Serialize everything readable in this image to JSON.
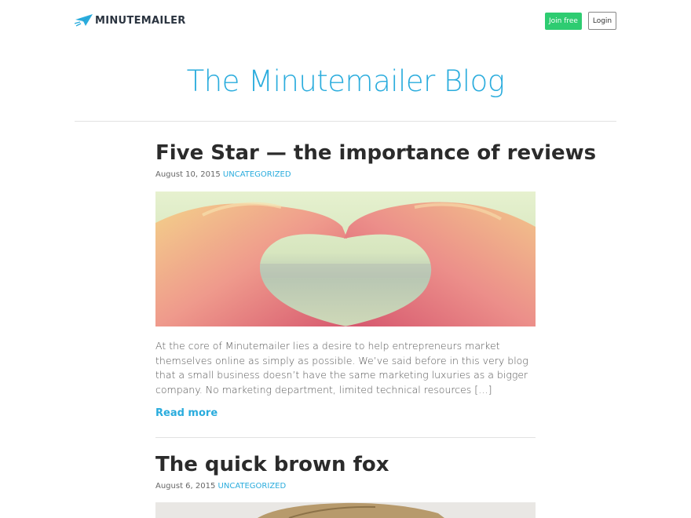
{
  "header": {
    "brand": "MINUTEMAILER",
    "join_label": "Join free",
    "login_label": "Login"
  },
  "page_title": "The Minutemailer Blog",
  "posts": [
    {
      "title": "Five Star — the importance of reviews",
      "date": "August 10, 2015",
      "category": "UNCATEGORIZED",
      "image_icon": "heart-hands-image",
      "excerpt": "At the core of Minutemailer lies a desire to help entrepreneurs market themselves online as simply as possible. We’ve said before in this very blog that a small business doesn’t have the same marketing luxuries as a bigger company. No marketing department, limited technical resources […]",
      "read_more": "Read more"
    },
    {
      "title": "The quick brown fox",
      "date": "August 6, 2015",
      "category": "UNCATEGORIZED",
      "image_icon": "fox-image"
    }
  ],
  "colors": {
    "accent": "#2aacdd",
    "join_button": "#2ecc71",
    "heading": "#2b2b2b"
  }
}
